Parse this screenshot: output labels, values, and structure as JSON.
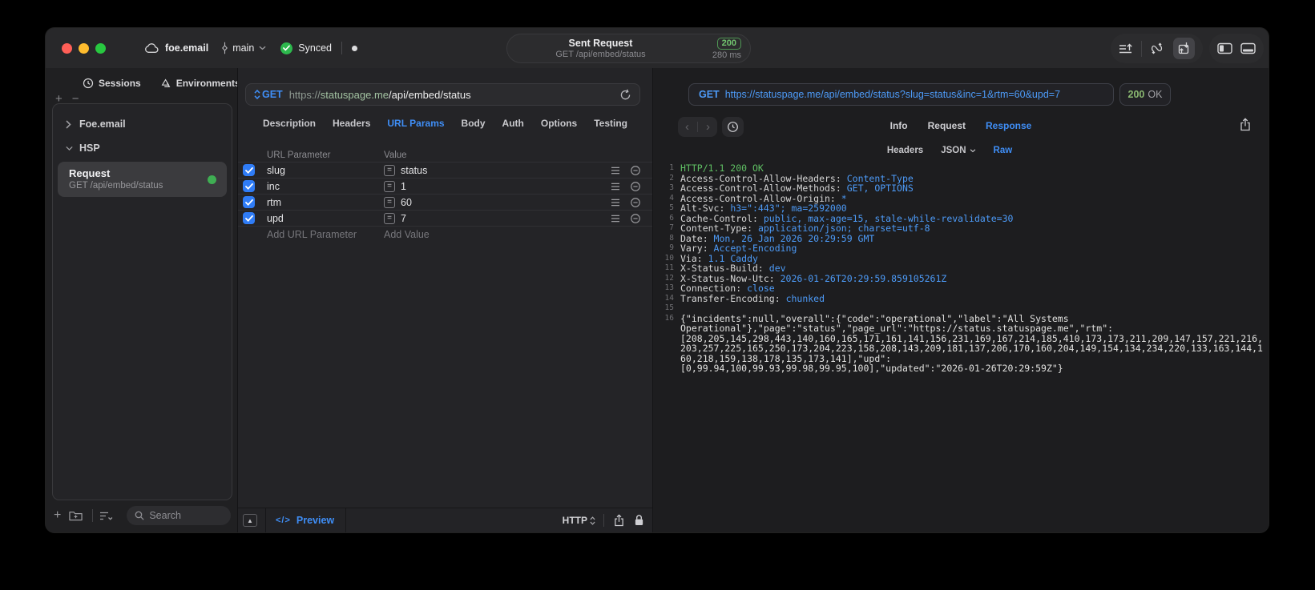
{
  "titlebar": {
    "project": "foe.email",
    "branch": "main",
    "sync_label": "Synced",
    "request_summary": {
      "title": "Sent Request",
      "method_path": "GET /api/embed/status",
      "status_code": "200",
      "duration": "280 ms"
    }
  },
  "sidebar": {
    "tabs": [
      {
        "label": "Sessions"
      },
      {
        "label": "Environments"
      }
    ],
    "tree": [
      {
        "label": "Foe.email"
      },
      {
        "label": "HSP"
      }
    ],
    "request_item": {
      "title": "Request",
      "subtitle": "GET /api/embed/status"
    },
    "search_placeholder": "Search"
  },
  "request_pane": {
    "method": "GET",
    "url": {
      "scheme": "https://",
      "host": "statuspage.me",
      "path": "/api/embed/status"
    },
    "tabs": [
      "Description",
      "Headers",
      "URL Params",
      "Body",
      "Auth",
      "Options",
      "Testing"
    ],
    "active_tab": "URL Params",
    "params": {
      "columns": [
        "URL Parameter",
        "Value"
      ],
      "rows": [
        {
          "name": "slug",
          "value": "status",
          "enabled": true
        },
        {
          "name": "inc",
          "value": "1",
          "enabled": true
        },
        {
          "name": "rtm",
          "value": "60",
          "enabled": true
        },
        {
          "name": "upd",
          "value": "7",
          "enabled": true
        }
      ],
      "add_row": {
        "name_placeholder": "Add URL Parameter",
        "value_placeholder": "Add Value"
      }
    },
    "footer": {
      "code_glyph": "</>",
      "preview_label": "Preview",
      "protocol": "HTTP"
    }
  },
  "response_pane": {
    "request_line": {
      "method": "GET",
      "url": "https://statuspage.me/api/embed/status?slug=status&inc=1&rtm=60&upd=7"
    },
    "status": {
      "code": "200",
      "text": "OK"
    },
    "tabs": [
      "Info",
      "Request",
      "Response"
    ],
    "active_tab": "Response",
    "subtabs": [
      "Headers",
      "JSON",
      "Raw"
    ],
    "active_subtab": "Raw",
    "body_lines": [
      {
        "n": "1",
        "parts": [
          {
            "t": "HTTP/1.1 200 OK",
            "c": "status"
          }
        ]
      },
      {
        "n": "2",
        "parts": [
          {
            "t": "Access-Control-Allow-Headers: ",
            "c": "name"
          },
          {
            "t": "Content-Type",
            "c": "value"
          }
        ]
      },
      {
        "n": "3",
        "parts": [
          {
            "t": "Access-Control-Allow-Methods: ",
            "c": "name"
          },
          {
            "t": "GET, OPTIONS",
            "c": "value"
          }
        ]
      },
      {
        "n": "4",
        "parts": [
          {
            "t": "Access-Control-Allow-Origin: ",
            "c": "name"
          },
          {
            "t": "*",
            "c": "value"
          }
        ]
      },
      {
        "n": "5",
        "parts": [
          {
            "t": "Alt-Svc: ",
            "c": "name"
          },
          {
            "t": "h3=\":443\"; ma=2592000",
            "c": "value"
          }
        ]
      },
      {
        "n": "6",
        "parts": [
          {
            "t": "Cache-Control: ",
            "c": "name"
          },
          {
            "t": "public, max-age=15, stale-while-revalidate=30",
            "c": "value"
          }
        ]
      },
      {
        "n": "7",
        "parts": [
          {
            "t": "Content-Type: ",
            "c": "name"
          },
          {
            "t": "application/json; charset=utf-8",
            "c": "value"
          }
        ]
      },
      {
        "n": "8",
        "parts": [
          {
            "t": "Date: ",
            "c": "name"
          },
          {
            "t": "Mon, 26 Jan 2026 20:29:59 GMT",
            "c": "value"
          }
        ]
      },
      {
        "n": "9",
        "parts": [
          {
            "t": "Vary: ",
            "c": "name"
          },
          {
            "t": "Accept-Encoding",
            "c": "value"
          }
        ]
      },
      {
        "n": "10",
        "parts": [
          {
            "t": "Via: ",
            "c": "name"
          },
          {
            "t": "1.1 Caddy",
            "c": "value"
          }
        ]
      },
      {
        "n": "11",
        "parts": [
          {
            "t": "X-Status-Build: ",
            "c": "name"
          },
          {
            "t": "dev",
            "c": "value"
          }
        ]
      },
      {
        "n": "12",
        "parts": [
          {
            "t": "X-Status-Now-Utc: ",
            "c": "name"
          },
          {
            "t": "2026-01-26T20:29:59.859105261Z",
            "c": "value"
          }
        ]
      },
      {
        "n": "13",
        "parts": [
          {
            "t": "Connection: ",
            "c": "name"
          },
          {
            "t": "close",
            "c": "value"
          }
        ]
      },
      {
        "n": "14",
        "parts": [
          {
            "t": "Transfer-Encoding: ",
            "c": "name"
          },
          {
            "t": "chunked",
            "c": "value"
          }
        ]
      },
      {
        "n": "15",
        "parts": []
      },
      {
        "n": "16",
        "parts": [
          {
            "t": "{\"incidents\":null,\"overall\":{\"code\":\"operational\",\"label\":\"All Systems",
            "c": "json"
          }
        ]
      },
      {
        "n": "",
        "parts": [
          {
            "t": "Operational\"},\"page\":\"status\",\"page_url\":\"https://status.statuspage.me\",\"rtm\":",
            "c": "json"
          }
        ]
      },
      {
        "n": "",
        "parts": [
          {
            "t": "[208,205,145,298,443,140,160,165,171,161,141,156,231,169,167,214,185,410,173,173,211,209,147,157,221,216,",
            "c": "json"
          }
        ]
      },
      {
        "n": "",
        "parts": [
          {
            "t": "203,257,225,165,250,173,204,223,158,208,143,209,181,137,206,170,160,204,149,154,134,234,220,133,163,144,1",
            "c": "json"
          }
        ]
      },
      {
        "n": "",
        "parts": [
          {
            "t": "60,218,159,138,178,135,173,141],\"upd\":",
            "c": "json"
          }
        ]
      },
      {
        "n": "",
        "parts": [
          {
            "t": "[0,99.94,100,99.93,99.98,99.95,100],\"updated\":\"2026-01-26T20:29:59Z\"}",
            "c": "json"
          }
        ]
      }
    ]
  },
  "colors": {
    "accent_blue": "#3f8ef6",
    "ok_green": "#72c570",
    "checkbox_blue": "#2f7cf6",
    "sync_green": "#2db84d"
  }
}
